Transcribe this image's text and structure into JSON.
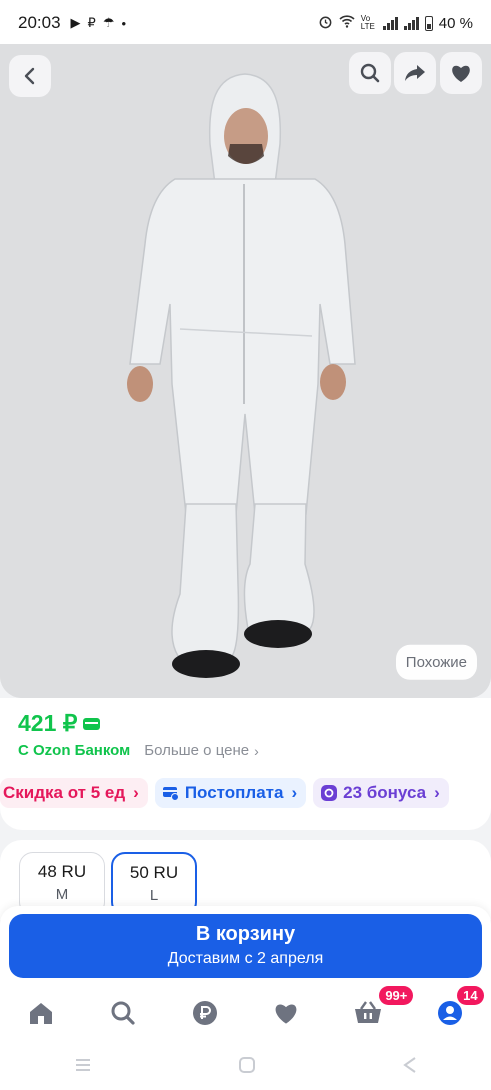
{
  "status_bar": {
    "time": "20:03",
    "notification_icons": [
      "▶",
      "₽",
      "☂",
      "•"
    ],
    "battery": "40 %",
    "network": "Vo LTE"
  },
  "header": {
    "back_icon": "chevron-left-icon",
    "search_icon": "search-icon",
    "share_icon": "share-arrow-icon",
    "favorite_icon": "heart-icon"
  },
  "product": {
    "similar_label": "Похожие",
    "price": "421 ₽",
    "bank_label": "С Ozon Банком",
    "more_price_label": "Больше о цене"
  },
  "promos": [
    {
      "label": "Скидка от 5 ед"
    },
    {
      "label": "Постоплата"
    },
    {
      "label": "23 бонуса"
    }
  ],
  "sizes": [
    {
      "ru": "48 RU",
      "letter": "M",
      "selected": false
    },
    {
      "ru": "50 RU",
      "letter": "L",
      "selected": true
    }
  ],
  "cart": {
    "button_label": "В корзину",
    "delivery_label": "Доставим с 2 апреля"
  },
  "bottom_nav": {
    "cart_badge": "99+",
    "profile_badge": "14"
  },
  "colors": {
    "accent": "#1a5fe6",
    "price_green": "#10c44c",
    "badge_pink": "#f2185e"
  }
}
